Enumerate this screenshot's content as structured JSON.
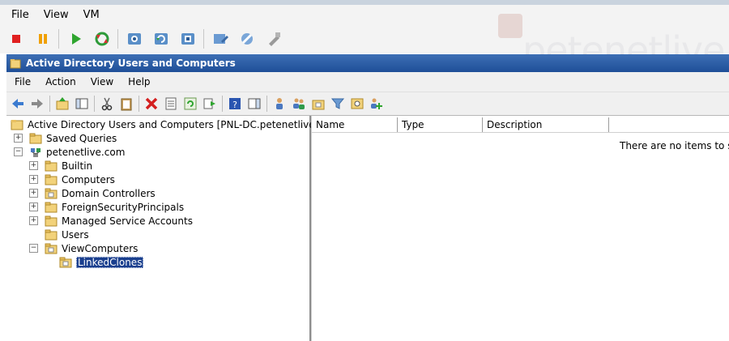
{
  "host": {
    "menu": [
      "File",
      "View",
      "VM"
    ],
    "toolbar_icons": [
      "stop-icon",
      "pause-icon",
      "play-icon",
      "reset-icon",
      "snapshot-icon",
      "revert-snapshot-icon",
      "manage-snapshots-icon",
      "settings-icon",
      "tools-icon",
      "remove-icon"
    ]
  },
  "watermark": {
    "text": "petenetlive"
  },
  "mmc": {
    "title": "Active Directory Users and Computers",
    "menu": [
      "File",
      "Action",
      "View",
      "Help"
    ]
  },
  "tree": {
    "root": "Active Directory Users and Computers [PNL-DC.petenetlive.com]",
    "items": [
      {
        "label": "Saved Queries"
      },
      {
        "label": "petenetlive.com"
      },
      {
        "label": "Builtin"
      },
      {
        "label": "Computers"
      },
      {
        "label": "Domain Controllers"
      },
      {
        "label": "ForeignSecurityPrincipals"
      },
      {
        "label": "Managed Service Accounts"
      },
      {
        "label": "Users"
      },
      {
        "label": "ViewComputers"
      },
      {
        "label": "LinkedClones"
      }
    ]
  },
  "list": {
    "columns": [
      "Name",
      "Type",
      "Description"
    ],
    "empty_message": "There are no items to show"
  },
  "colors": {
    "title_bar": "#1f4f98",
    "selection": "#1a3f8e"
  }
}
